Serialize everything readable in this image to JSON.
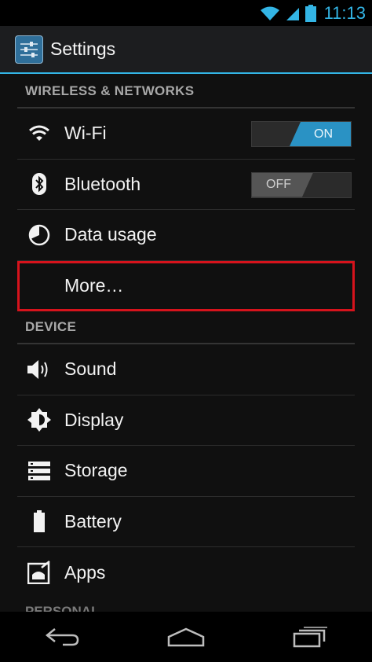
{
  "status_bar": {
    "time": "11:13",
    "icons": [
      "wifi-icon",
      "signal-icon",
      "battery-icon"
    ]
  },
  "action_bar": {
    "title": "Settings",
    "icon": "settings-app-icon"
  },
  "sections": {
    "wireless": {
      "header": "WIRELESS & NETWORKS",
      "wifi": {
        "label": "Wi-Fi",
        "toggle": "ON",
        "icon": "wifi-icon"
      },
      "bluetooth": {
        "label": "Bluetooth",
        "toggle": "OFF",
        "icon": "bluetooth-icon"
      },
      "data_usage": {
        "label": "Data usage",
        "icon": "data-usage-icon"
      },
      "more": {
        "label": "More…"
      }
    },
    "device": {
      "header": "DEVICE",
      "sound": {
        "label": "Sound",
        "icon": "sound-icon"
      },
      "display": {
        "label": "Display",
        "icon": "display-icon"
      },
      "storage": {
        "label": "Storage",
        "icon": "storage-icon"
      },
      "battery": {
        "label": "Battery",
        "icon": "battery-icon"
      },
      "apps": {
        "label": "Apps",
        "icon": "apps-icon"
      }
    },
    "personal": {
      "header": "PERSONAL"
    }
  },
  "nav_bar": {
    "buttons": [
      "back-icon",
      "home-icon",
      "recent-apps-icon"
    ]
  },
  "colors": {
    "accent": "#33b5e5",
    "toggle_on": "#2a92c4",
    "highlight": "#d6131c"
  }
}
